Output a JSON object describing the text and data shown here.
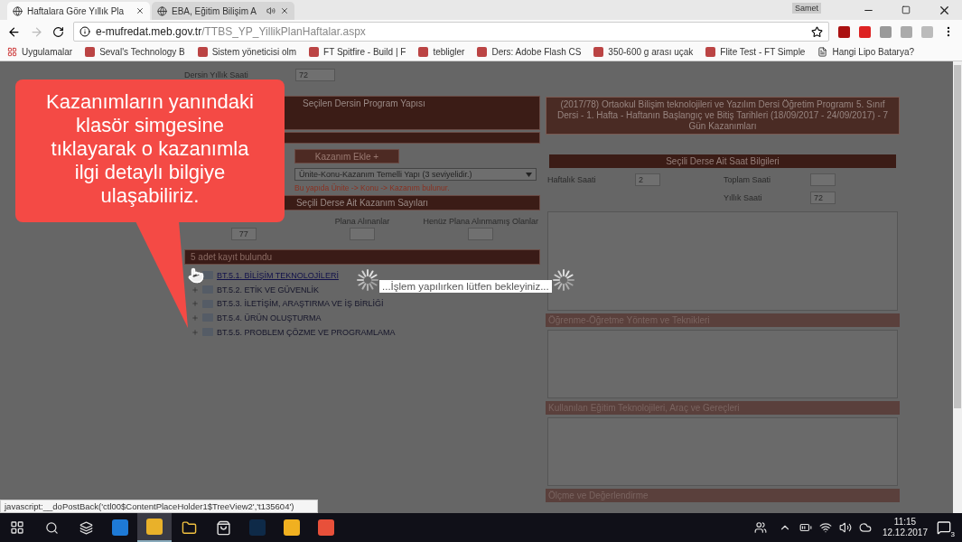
{
  "browser": {
    "tabs": [
      {
        "title": "Haftalara Göre Yıllık Pla",
        "selected": true,
        "audio": false
      },
      {
        "title": "EBA, Eğitim Bilişim A",
        "selected": false,
        "audio": true
      }
    ],
    "user": "Samet",
    "url": {
      "host": "e-mufredat.meb.gov.tr",
      "path": "/TTBS_YP_YillikPlanHaftalar.aspx"
    },
    "bookmarks": [
      "Uygulamalar",
      "Seval's Technology B",
      "Sistem yöneticisi olm",
      "FT Spitfire - Build | F",
      "tebligler",
      "Ders: Adobe Flash CS",
      "350-600 g arası uçak",
      "Flite Test - FT Simple",
      "Hangi Lipo Batarya?"
    ]
  },
  "page": {
    "left": {
      "year_hours": {
        "label": "Dersin Yıllık Saati",
        "value": "72"
      },
      "program_header": "Seçilen Dersin Program Yapısı",
      "add_button": "Kazanım Ekle +",
      "structure_select": "Ünite-Konu-Kazanım Temelli Yapı (3 seviyelidir.)",
      "structure_note": "Bu yapıda Ünite -> Konu -> Kazanım bulunur.",
      "counts_header": "Seçili Derse Ait Kazanım Sayıları",
      "counts": [
        {
          "value": "77"
        },
        {
          "label": "Plana Alınanlar"
        },
        {
          "label": "Henüz Plana Alınmamış Olanlar"
        }
      ],
      "results_header": "5 adet kayıt bulundu",
      "tree": [
        {
          "label": "BT.5.1. BİLİŞİM TEKNOLOJİLERİ",
          "hovered": true
        },
        {
          "label": "BT.5.2. ETİK VE GÜVENLİK",
          "hovered": false
        },
        {
          "label": "BT.5.3. İLETİŞİM, ARAŞTIRMA VE İŞ BİRLİĞİ",
          "hovered": false
        },
        {
          "label": "BT.5.4. ÜRÜN OLUŞTURMA",
          "hovered": false
        },
        {
          "label": "BT.5.5. PROBLEM ÇÖZME VE PROGRAMLAMA",
          "hovered": false
        }
      ]
    },
    "right": {
      "title": "(2017/78) Ortaokul Bilişim teknolojileri ve Yazılım Dersi Öğretim Programı 5. Sınıf Dersi - 1. Hafta - Haftanın Başlangıç ve Bitiş Tarihleri (18/09/2017 - 24/09/2017) - 7 Gün Kazanımları",
      "hours_header": "Seçili Derse Ait Saat Bilgileri",
      "hours": [
        {
          "label": "Haftalık Saati",
          "value": "2"
        },
        {
          "label": "Toplam Saati"
        },
        {
          "label": "Yıllık Saati",
          "value": "72"
        }
      ],
      "sections": [
        "Öğrenme-Öğretme Yöntem ve Teknikleri",
        "Kullanılan Eğitim Teknolojileri, Araç ve Gereçleri",
        "Ölçme ve Değerlendirme"
      ]
    },
    "loading": "...İşlem yapılırken lütfen bekleyiniz...",
    "callout": "Kazanımların yanındaki klasör simgesine tıklayarak o kazanımla ilgi detaylı bilgiye ulaşabiliriz."
  },
  "status_link": "javascript:__doPostBack('ctl00$ContentPlaceHolder1$TreeView2','t135604')",
  "taskbar": {
    "time": "11:15",
    "date": "12.12.2017",
    "notifications": "3"
  }
}
